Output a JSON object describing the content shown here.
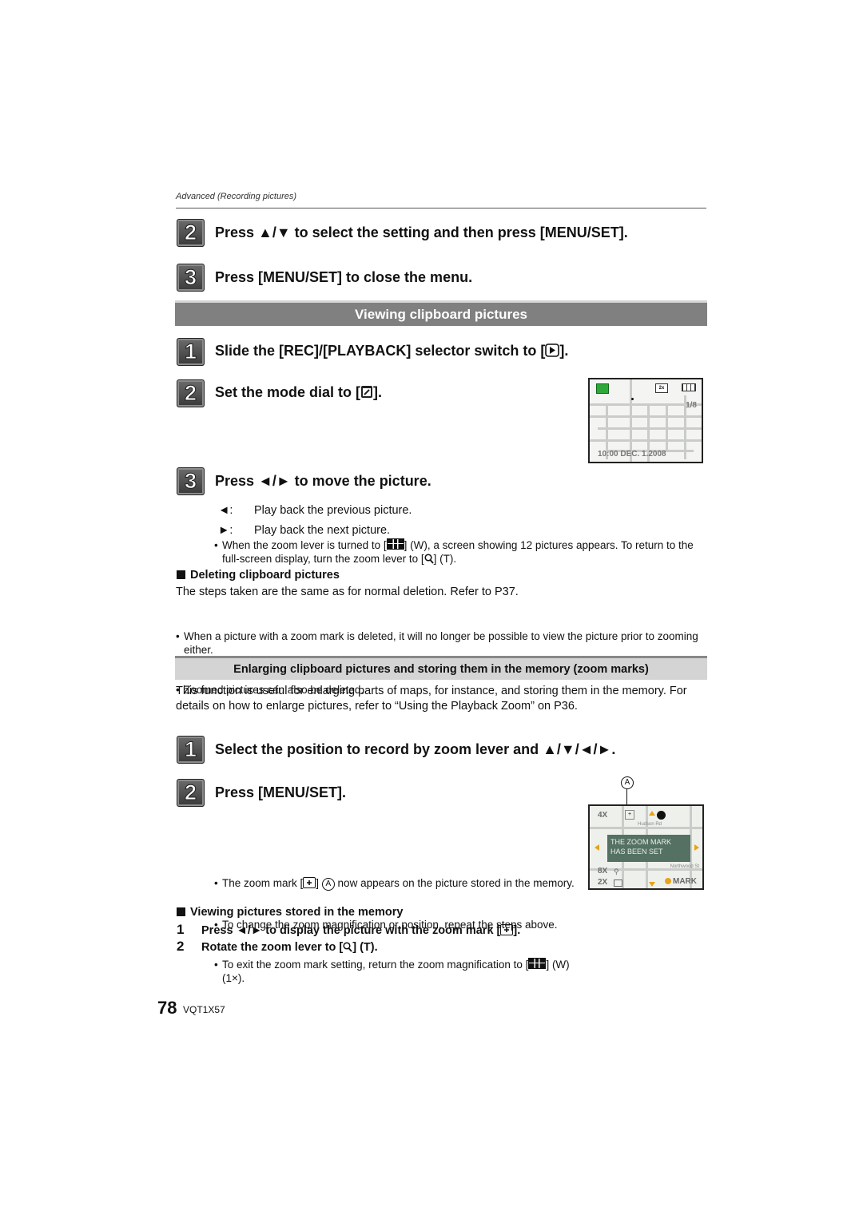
{
  "header": {
    "section_label": "Advanced (Recording pictures)"
  },
  "top_steps": [
    {
      "number": "2",
      "text": "Press ▲/▼ to select the setting and then press [MENU/SET]."
    },
    {
      "number": "3",
      "text": "Press [MENU/SET] to close the menu."
    }
  ],
  "viewing_section": {
    "title": "Viewing clipboard pictures",
    "steps": [
      {
        "number": "1",
        "text_before": "Slide the [REC]/[PLAYBACK] selector switch to [",
        "icon": "playback-icon",
        "text_after": "]."
      },
      {
        "number": "2",
        "text_before": "Set the mode dial to [",
        "icon": "clipboard-mode-icon",
        "text_after": "]."
      },
      {
        "number": "3",
        "text": "Press ◄/► to move the picture."
      }
    ],
    "screen_preview": {
      "zoom_badge": "2x",
      "frame_counter": "1/8",
      "datetime": "10:00  DEC. 1.2008",
      "battery_icon": "battery-icon",
      "clipboard_icon": "clipboard-icon"
    },
    "key_actions": [
      {
        "key": "◄:",
        "text": "Play back the previous picture."
      },
      {
        "key": "►:",
        "text": "Play back the next picture."
      }
    ],
    "note": {
      "part1": "When the zoom lever is turned to [",
      "icon1": "multi-playback-icon",
      "part2": "] (W), a screen showing 12 pictures appears. To return to the full-screen display, turn the zoom lever to [",
      "icon2": "zoom-magnifier-icon",
      "part3": "] (T)."
    }
  },
  "deleting": {
    "title": "Deleting clipboard pictures",
    "body": "The steps taken are the same as for normal deletion. Refer to P37.",
    "bullets": [
      "When a picture with a zoom mark is deleted, it will no longer be possible to view the picture prior to zooming either.",
      "Zoomed pictures can also be deleted."
    ]
  },
  "zoom_marks_section": {
    "title": "Enlarging clipboard pictures and storing them in the memory (zoom marks)",
    "intro": "This function is useful for enlarging parts of maps, for instance, and storing them in the memory. For details on how to enlarge pictures, refer to “Using the Playback Zoom” on P36.",
    "steps": [
      {
        "number": "1",
        "text": "Select the position to record by zoom lever and ▲/▼/◄/►."
      },
      {
        "number": "2",
        "text": "Press [MENU/SET]."
      }
    ],
    "callout_label": "A",
    "bullets": [
      {
        "part1": "The zoom mark [",
        "icon": "zoom-mark-icon",
        "part2": "] ",
        "circled": "A",
        "part3": " now appears on the picture stored in the memory."
      },
      {
        "text": "To change the zoom magnification or position, repeat the steps above."
      },
      {
        "part1": "To exit the zoom mark setting, return the zoom magnification to [",
        "icon": "multi-playback-icon",
        "part2": "] (W) (1×)."
      }
    ],
    "screen_preview": {
      "zoom_level": "4X",
      "street1": "Hudson Rd",
      "street2": "Northwood St",
      "message": "THE ZOOM MARK HAS BEEN SET",
      "zoom_options": [
        "8X",
        "2X"
      ],
      "mark_label": "MARK"
    }
  },
  "viewing_memory": {
    "title": "Viewing pictures stored in the memory",
    "steps": [
      {
        "number": "1",
        "part1": "Press ◄/► to display the picture with the zoom mark [",
        "icon": "zoom-mark-icon",
        "part2": "]."
      },
      {
        "number": "2",
        "part1": "Rotate the zoom lever to [",
        "icon": "zoom-magnifier-icon",
        "part2": "] (T)."
      }
    ]
  },
  "footer": {
    "page_number": "78",
    "model_code": "VQT1X57"
  }
}
